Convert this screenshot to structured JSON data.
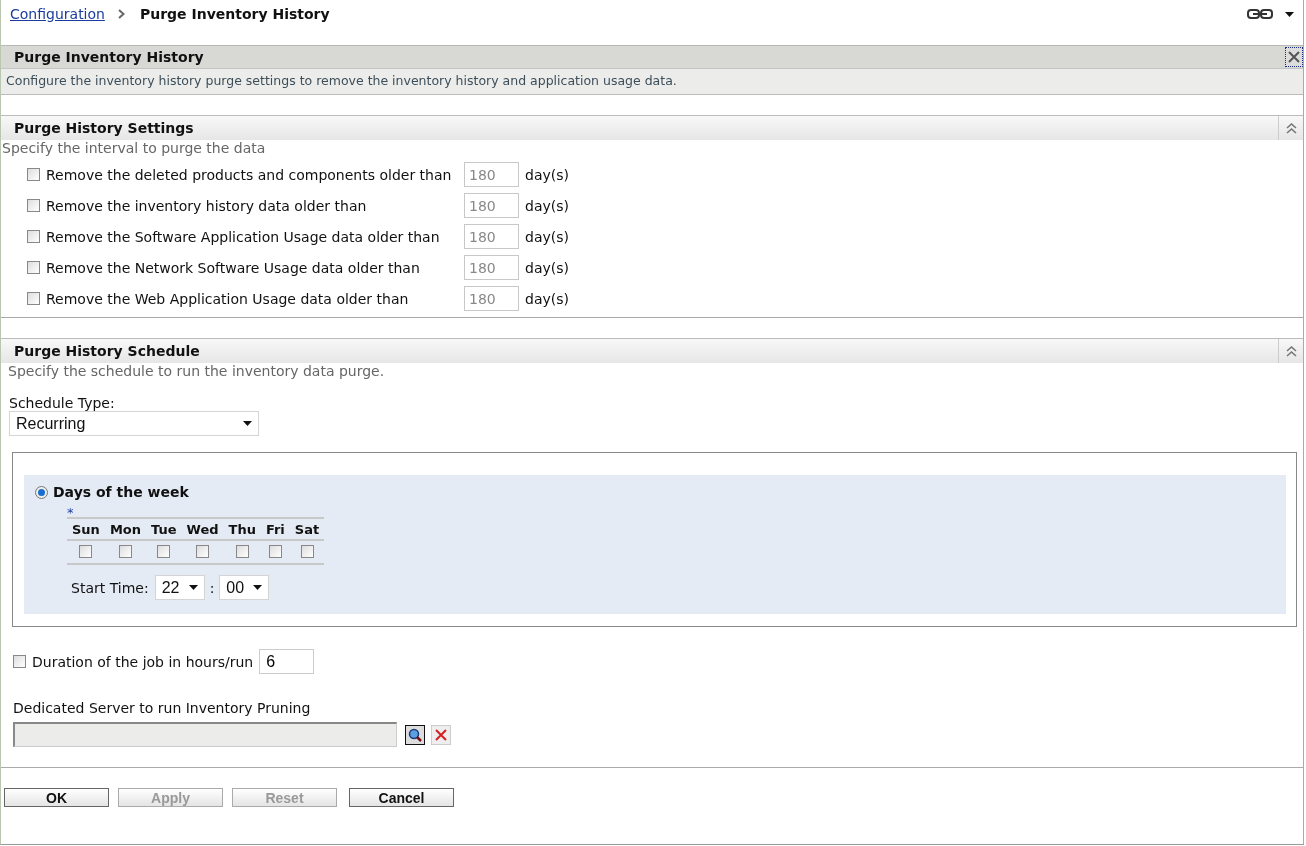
{
  "breadcrumb": {
    "link": "Configuration",
    "current": "Purge Inventory History"
  },
  "panel": {
    "title": "Purge Inventory History",
    "description": "Configure the inventory history purge settings to remove the inventory history and application usage data."
  },
  "settings": {
    "title": "Purge History Settings",
    "hint": "Specify the interval to purge the data",
    "rows": [
      {
        "label": "Remove the deleted products and components older than",
        "checked": false,
        "value": "180",
        "unit": "day(s)"
      },
      {
        "label": "Remove the inventory history data older than",
        "checked": false,
        "value": "180",
        "unit": "day(s)"
      },
      {
        "label": "Remove the Software Application Usage data older than",
        "checked": false,
        "value": "180",
        "unit": "day(s)"
      },
      {
        "label": "Remove the Network Software Usage data older than",
        "checked": false,
        "value": "180",
        "unit": "day(s)"
      },
      {
        "label": "Remove the Web Application Usage data older than",
        "checked": false,
        "value": "180",
        "unit": "day(s)"
      }
    ]
  },
  "schedule": {
    "title": "Purge History Schedule",
    "hint": "Specify the schedule to run the inventory data purge.",
    "type_label": "Schedule Type:",
    "type_value": "Recurring",
    "option": {
      "label": "Days of the week",
      "selected": true
    },
    "required_mark": "*",
    "days": [
      {
        "label": "Sun",
        "checked": false
      },
      {
        "label": "Mon",
        "checked": false
      },
      {
        "label": "Tue",
        "checked": false
      },
      {
        "label": "Wed",
        "checked": false
      },
      {
        "label": "Thu",
        "checked": false
      },
      {
        "label": "Fri",
        "checked": false
      },
      {
        "label": "Sat",
        "checked": false
      }
    ],
    "start_time_label": "Start Time:",
    "hour": "22",
    "separator": ":",
    "minute": "00"
  },
  "duration": {
    "label": "Duration of the job in hours/run",
    "checked": false,
    "value": "6"
  },
  "server": {
    "label": "Dedicated Server to run Inventory Pruning"
  },
  "buttons": [
    {
      "label": "OK",
      "disabled": false
    },
    {
      "label": "Apply",
      "disabled": true
    },
    {
      "label": "Reset",
      "disabled": true
    },
    {
      "label": "Cancel",
      "disabled": false
    }
  ]
}
